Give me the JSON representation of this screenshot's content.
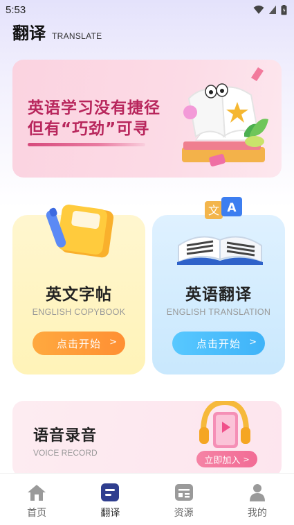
{
  "status_bar": {
    "time": "5:53"
  },
  "header": {
    "title": "翻译",
    "subtitle": "TRANSLATE"
  },
  "banner": {
    "line1": "英语学习没有捷径",
    "line2": "但有“巧劲”可寻"
  },
  "cards": [
    {
      "title": "英文字帖",
      "subtitle": "ENGLISH COPYBOOK",
      "button": "点击开始",
      "chevron": ">"
    },
    {
      "title": "英语翻译",
      "subtitle": "ENGLISH TRANSLATION",
      "button": "点击开始",
      "chevron": ">"
    }
  ],
  "voice": {
    "title": "语音录音",
    "subtitle": "VOICE RECORD",
    "button": "立即加入",
    "chevron": ">"
  },
  "tabbar": {
    "active_index": 1,
    "items": [
      {
        "label": "首页",
        "icon": "home-icon"
      },
      {
        "label": "翻译",
        "icon": "translate-doc-icon"
      },
      {
        "label": "资源",
        "icon": "resources-icon"
      },
      {
        "label": "我的",
        "icon": "profile-icon"
      }
    ]
  },
  "colors": {
    "banner_text": "#b8265c",
    "orange_button": "#ff9a38",
    "blue_button": "#48bdfb",
    "pink_button": "#f2769b",
    "tab_active": "#2f3e8f",
    "tab_inactive": "#9a9a9a"
  }
}
